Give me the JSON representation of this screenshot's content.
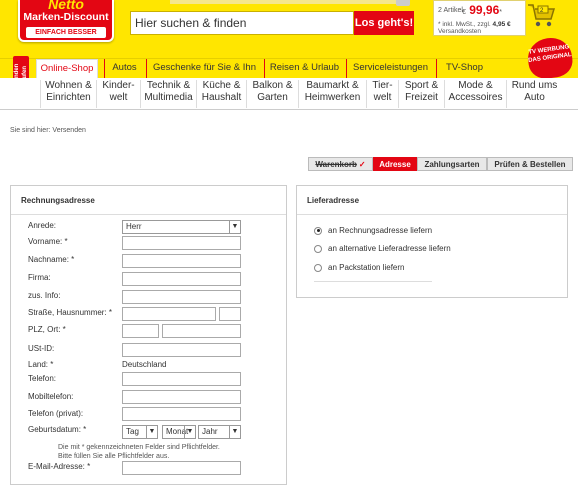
{
  "header": {
    "logo_line1": "Netto",
    "logo_line2": "Marken-Discount",
    "logo_line3": "EINFACH BESSER",
    "search_placeholder": "Hier suchen & finden",
    "search_button": "Los geht's!",
    "cart_count": "2 Artikel",
    "cart_currency": "€",
    "cart_price": "99,96",
    "cart_tax_line1": "* inkl. MwSt., zzgl.",
    "cart_shipping": "4,95 €",
    "cart_tax_line2": "Versandkosten"
  },
  "badge_24h": "24 Stunden einkaufen",
  "tv_badge": "TV WERBUNG DAS ORIGINAL",
  "nav_tabs": [
    "Online-Shop",
    "Autos",
    "Geschenke für Sie & Ihn",
    "Reisen & Urlaub",
    "Serviceleistungen",
    "TV-Shop"
  ],
  "categories": [
    {
      "l1": "Wohnen &",
      "l2": "Einrichten"
    },
    {
      "l1": "Kinder-",
      "l2": "welt"
    },
    {
      "l1": "Technik &",
      "l2": "Multimedia"
    },
    {
      "l1": "Küche &",
      "l2": "Haushalt"
    },
    {
      "l1": "Balkon &",
      "l2": "Garten"
    },
    {
      "l1": "Baumarkt &",
      "l2": "Heimwerken"
    },
    {
      "l1": "Tier-",
      "l2": "welt"
    },
    {
      "l1": "Sport &",
      "l2": "Freizeit"
    },
    {
      "l1": "Mode &",
      "l2": "Accessoires"
    },
    {
      "l1": "Rund ums",
      "l2": "Auto"
    }
  ],
  "breadcrumb": "Sie sind hier: Versenden",
  "steps": [
    "Warenkorb",
    "Adresse",
    "Zahlungsarten",
    "Prüfen & Bestellen"
  ],
  "billing": {
    "title": "Rechnungsadresse",
    "labels": {
      "salutation": "Anrede:",
      "firstname": "Vorname: *",
      "lastname": "Nachname: *",
      "company": "Firma:",
      "extra": "zus. Info:",
      "street": "Straße, Hausnummer: *",
      "zip_city": "PLZ, Ort: *",
      "vat": "USt-ID:",
      "country": "Land: *",
      "phone": "Telefon:",
      "mobile": "Mobiltelefon:",
      "phone_private": "Telefon (privat):",
      "birthdate": "Geburtsdatum: *",
      "email": "E-Mail-Adresse: *"
    },
    "salutation_value": "Herr",
    "country_value": "Deutschland",
    "birth_day": "Tag",
    "birth_month": "Monat",
    "birth_year": "Jahr",
    "note_line1": "Die mit * gekennzeichneten Felder sind Pflichtfelder.",
    "note_line2": "Bitte füllen Sie alle Pflichtfelder aus."
  },
  "shipping": {
    "title": "Lieferadresse",
    "options": [
      "an Rechnungsadresse liefern",
      "an alternative Lieferadresse liefern",
      "an Packstation liefern"
    ],
    "selected_index": 0
  },
  "colors": {
    "brand_yellow": "#ffe600",
    "brand_red": "#e30613"
  }
}
